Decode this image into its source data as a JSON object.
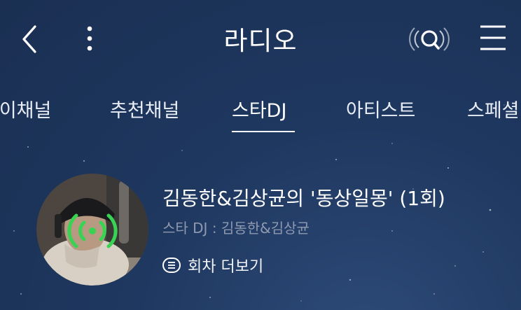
{
  "header": {
    "title": "라디오",
    "icons": [
      "back-icon",
      "more-vertical-icon",
      "search-icon",
      "menu-icon"
    ]
  },
  "tabs": [
    {
      "label": "마이채널",
      "active": false
    },
    {
      "label": "추천채널",
      "active": false
    },
    {
      "label": "스타DJ",
      "active": true
    },
    {
      "label": "아티스트",
      "active": false
    },
    {
      "label": "스페셜",
      "active": false
    }
  ],
  "program": {
    "title": "김동한&김상균의 '동상일몽' (1회)",
    "dj": "스타 DJ : 김동한&김상균",
    "episodes_label": "회차 더보기",
    "live_icon": "broadcast-icon",
    "live_color": "#39d353"
  },
  "colors": {
    "background": "#1f3860",
    "subtext": "#8f9ab0",
    "accent": "#39d353"
  }
}
